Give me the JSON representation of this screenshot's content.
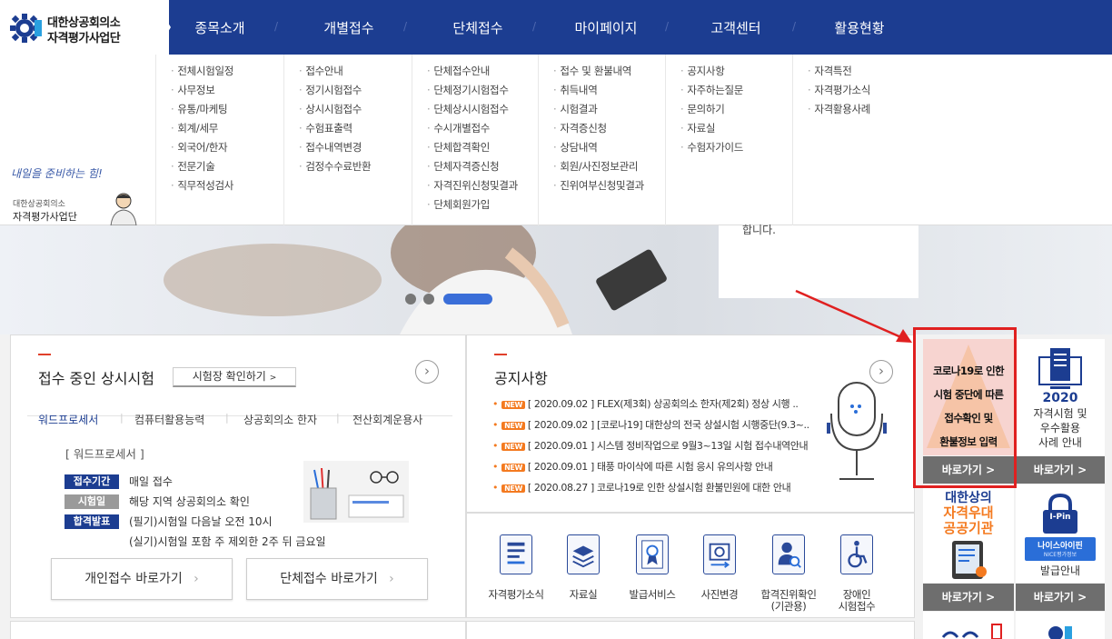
{
  "logo": {
    "line1": "대한상공회의소",
    "line2": "자격평가사업단"
  },
  "nav": [
    "종목소개",
    "개별접수",
    "단체접수",
    "마이페이지",
    "고객센터",
    "활용현황"
  ],
  "side": {
    "slogan": "내일을 준비하는 힘!",
    "org1": "대한상공회의소",
    "org2": "자격평가사업단"
  },
  "menu": [
    [
      "전체시험일정",
      "사무정보",
      "유통/마케팅",
      "회계/세무",
      "외국어/한자",
      "전문기술",
      "직무적성검사"
    ],
    [
      "접수안내",
      "정기시험접수",
      "상시시험접수",
      "수험표출력",
      "접수내역변경",
      "검정수수료반환"
    ],
    [
      "단체접수안내",
      "단체정기시험접수",
      "단체상시시험접수",
      "수시개별접수",
      "단체합격확인",
      "단체자격증신청",
      "자격진위신청및결과",
      "단체회원가입"
    ],
    [
      "접수 및 환불내역",
      "취득내역",
      "시험결과",
      "자격증신청",
      "상담내역",
      "회원/사진정보관리",
      "진위여부신청및결과"
    ],
    [
      "공지사항",
      "자주하는질문",
      "문의하기",
      "자료실",
      "수험자가이드"
    ],
    [
      "자격특전",
      "자격평가소식",
      "자격활용사례"
    ]
  ],
  "banner_text": "합니다.",
  "exam": {
    "title": "접수 중인 상시시험",
    "check_btn": "시험장 확인하기",
    "tabs": [
      "워드프로세서",
      "컴퓨터활용능력",
      "상공회의소 한자",
      "전산회계운용사"
    ],
    "subject": "[ 워드프로세서 ]",
    "rows": [
      {
        "badge": "접수기간",
        "text": "매일 접수"
      },
      {
        "badge": "시험일",
        "text": "해당 지역 상공회의소 확인"
      },
      {
        "badge": "합격발표",
        "text": "(필기)시험일 다음날 오전 10시"
      }
    ],
    "extra": "(실기)시험일 포함 주 제외한 2주 뒤 금요일",
    "btn_individual": "개인접수 바로가기",
    "btn_group": "단체접수 바로가기"
  },
  "notice": {
    "title": "공지사항",
    "new_tag": "NEW",
    "items": [
      "[ 2020.09.02 ] FLEX(제3회) 상공회의소 한자(제2회) 정상 시행 ..",
      "[ 2020.09.02 ] [코로나19] 대한상의 전국 상설시험 시행중단(9.3~..",
      "[ 2020.09.01 ] 시스템 정비작업으로 9월3~13일 시험 접수내역안내",
      "[ 2020.09.01 ] 태풍 마이삭에 따른 시험 응시 유의사항 안내",
      "[ 2020.08.27 ] 코로나19로 인한 상설시험 환불민원에 대한 안내"
    ]
  },
  "quick": [
    "자격평가소식",
    "자료실",
    "발급서비스",
    "사진변경",
    "합격진위확인\n(기관용)",
    "장애인\n시험접수"
  ],
  "side_cards": {
    "covid": [
      "코로나19로 인한",
      "시험 중단에 따른",
      "접수확인 및",
      "환불정보 입력"
    ],
    "year": "2020",
    "year_desc": [
      "자격시험 및",
      "우수활용",
      "사례 안내"
    ],
    "pref": [
      "대한상의",
      "자격우대",
      "공공기관"
    ],
    "ipin_label": "I-Pin",
    "ipin_brand": "나이스아이핀",
    "ipin_sub": "NICE평가정보",
    "issue": "발급안내",
    "go": "바로가기 >"
  }
}
